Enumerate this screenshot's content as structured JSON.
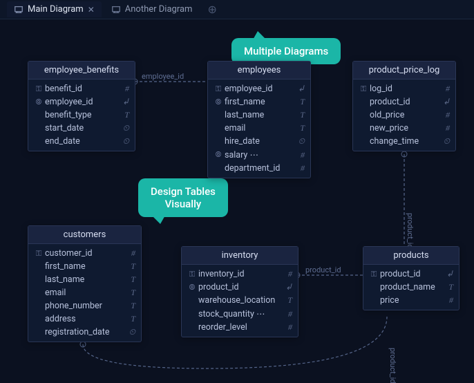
{
  "tabs": {
    "active": {
      "label": "Main Diagram"
    },
    "other": {
      "label": "Another Diagram"
    }
  },
  "callouts": {
    "multi": "Multiple Diagrams",
    "design1": "Design Tables",
    "design2": "Visually"
  },
  "links": {
    "emp_benefits_to_emp": "employee_id",
    "inv_to_products": "product_id",
    "pricelog_to_products": "product_id",
    "cust_to_products": "product_id"
  },
  "tables": {
    "employee_benefits": {
      "title": "employee_benefits",
      "cols": [
        {
          "lead": "key",
          "name": "benefit_id",
          "type": "#"
        },
        {
          "lead": "fk",
          "name": "employee_id",
          "type": "↲"
        },
        {
          "lead": "",
          "name": "benefit_type",
          "type": "T"
        },
        {
          "lead": "",
          "name": "start_date",
          "type": "⏲"
        },
        {
          "lead": "",
          "name": "end_date",
          "type": "⏲"
        }
      ]
    },
    "employees": {
      "title": "employees",
      "cols": [
        {
          "lead": "key",
          "name": "employee_id",
          "type": "↲"
        },
        {
          "lead": "fk",
          "name": "first_name",
          "type": "T"
        },
        {
          "lead": "",
          "name": "last_name",
          "type": "T"
        },
        {
          "lead": "",
          "name": "email",
          "type": "T"
        },
        {
          "lead": "",
          "name": "hire_date",
          "type": "⏲"
        },
        {
          "lead": "fk",
          "name": "salary ⋯",
          "type": "#"
        },
        {
          "lead": "",
          "name": "department_id",
          "type": "#"
        }
      ]
    },
    "product_price_log": {
      "title": "product_price_log",
      "cols": [
        {
          "lead": "key",
          "name": "log_id",
          "type": "#"
        },
        {
          "lead": "",
          "name": "product_id",
          "type": "↲"
        },
        {
          "lead": "",
          "name": "old_price",
          "type": "#"
        },
        {
          "lead": "",
          "name": "new_price",
          "type": "#"
        },
        {
          "lead": "",
          "name": "change_time",
          "type": "⏲"
        }
      ]
    },
    "customers": {
      "title": "customers",
      "cols": [
        {
          "lead": "key",
          "name": "customer_id",
          "type": "#"
        },
        {
          "lead": "",
          "name": "first_name",
          "type": "T"
        },
        {
          "lead": "",
          "name": "last_name",
          "type": "T"
        },
        {
          "lead": "",
          "name": "email",
          "type": "T"
        },
        {
          "lead": "",
          "name": "phone_number",
          "type": "T"
        },
        {
          "lead": "",
          "name": "address",
          "type": "T"
        },
        {
          "lead": "",
          "name": "registration_date",
          "type": "⏲"
        }
      ]
    },
    "inventory": {
      "title": "inventory",
      "cols": [
        {
          "lead": "key",
          "name": "inventory_id",
          "type": "#"
        },
        {
          "lead": "fk",
          "name": "product_id",
          "type": "↲"
        },
        {
          "lead": "",
          "name": "warehouse_location",
          "type": "T"
        },
        {
          "lead": "",
          "name": "stock_quantity ⋯",
          "type": "#"
        },
        {
          "lead": "",
          "name": "reorder_level",
          "type": "#"
        }
      ]
    },
    "products": {
      "title": "products",
      "cols": [
        {
          "lead": "key",
          "name": "product_id",
          "type": "↲"
        },
        {
          "lead": "",
          "name": "product_name",
          "type": "T"
        },
        {
          "lead": "",
          "name": "price",
          "type": "#"
        }
      ]
    }
  }
}
